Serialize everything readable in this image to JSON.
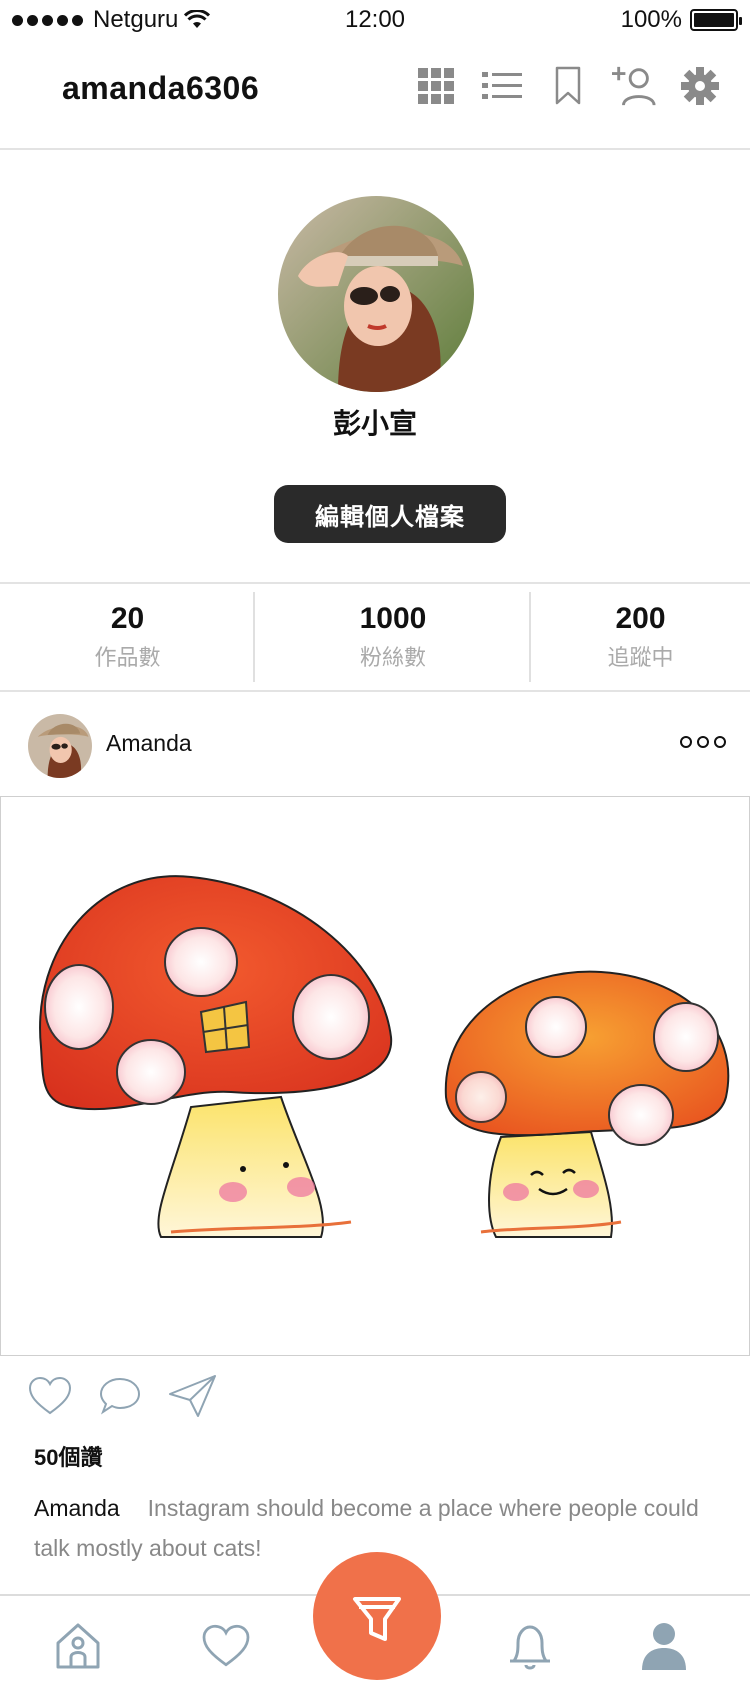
{
  "status_bar": {
    "carrier": "Netguru",
    "time": "12:00",
    "battery": "100%"
  },
  "header": {
    "username": "amanda6306",
    "icons": [
      "grid-icon",
      "list-icon",
      "bookmark-icon",
      "add-user-icon",
      "gear-icon"
    ]
  },
  "profile": {
    "display_name": "彭小宣",
    "edit_button_label": "編輯個人檔案"
  },
  "stats": [
    {
      "value": "20",
      "label": "作品數"
    },
    {
      "value": "1000",
      "label": "粉絲數"
    },
    {
      "value": "200",
      "label": "追蹤中"
    }
  ],
  "post": {
    "author": "Amanda",
    "likes": "50個讚",
    "caption_author": "Amanda",
    "caption_text": "Instagram should become a place where people could talk mostly about cats!"
  },
  "bottom_nav": {
    "items": [
      "home-icon",
      "heart-icon",
      "filter-icon",
      "bell-icon",
      "profile-icon"
    ],
    "accent_color": "#f0714a"
  }
}
